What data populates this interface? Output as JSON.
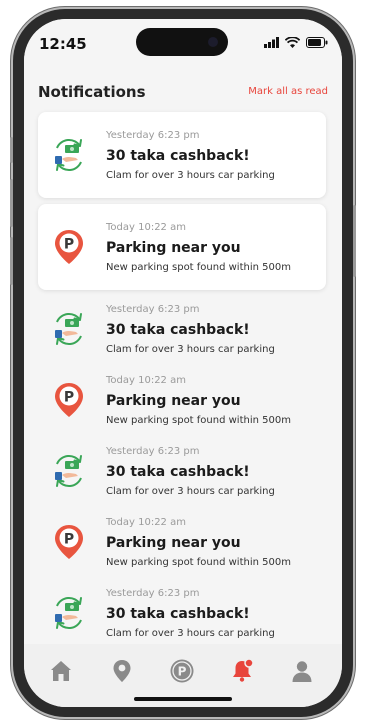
{
  "status_bar": {
    "time": "12:45"
  },
  "header": {
    "title": "Notifications",
    "mark_all_label": "Mark all as read"
  },
  "notifications": [
    {
      "type": "cashback",
      "time": "Yesterday 6:23 pm",
      "title": "30 taka cashback!",
      "description": "Clam for over 3 hours car parking",
      "unread": true,
      "icon": "cashback-icon"
    },
    {
      "type": "parking",
      "time": "Today 10:22 am",
      "title": "Parking near you",
      "description": "New parking spot found within 500m",
      "unread": true,
      "icon": "parking-pin-icon"
    },
    {
      "type": "cashback",
      "time": "Yesterday 6:23 pm",
      "title": "30 taka cashback!",
      "description": "Clam for over 3 hours car parking",
      "unread": false,
      "icon": "cashback-icon"
    },
    {
      "type": "parking",
      "time": "Today 10:22 am",
      "title": "Parking near you",
      "description": "New parking spot found within 500m",
      "unread": false,
      "icon": "parking-pin-icon"
    },
    {
      "type": "cashback",
      "time": "Yesterday 6:23 pm",
      "title": "30 taka cashback!",
      "description": "Clam for over 3 hours car parking",
      "unread": false,
      "icon": "cashback-icon"
    },
    {
      "type": "parking",
      "time": "Today 10:22 am",
      "title": "Parking near you",
      "description": "New parking spot found within 500m",
      "unread": false,
      "icon": "parking-pin-icon"
    },
    {
      "type": "cashback",
      "time": "Yesterday 6:23 pm",
      "title": "30 taka cashback!",
      "description": "Clam for over 3 hours car parking",
      "unread": false,
      "icon": "cashback-icon"
    }
  ],
  "tab_bar": {
    "tabs": [
      {
        "name": "home",
        "icon": "home-icon",
        "active": false
      },
      {
        "name": "location",
        "icon": "location-pin-icon",
        "active": false
      },
      {
        "name": "parking",
        "icon": "parking-icon",
        "active": false
      },
      {
        "name": "notifications",
        "icon": "bell-icon",
        "active": true
      },
      {
        "name": "profile",
        "icon": "user-icon",
        "active": false
      }
    ]
  },
  "colors": {
    "accent": "#e8453c",
    "background": "#f5f5f5",
    "card": "#ffffff",
    "icon_inactive": "#8a8a8a",
    "cashback_green": "#3aa657"
  }
}
